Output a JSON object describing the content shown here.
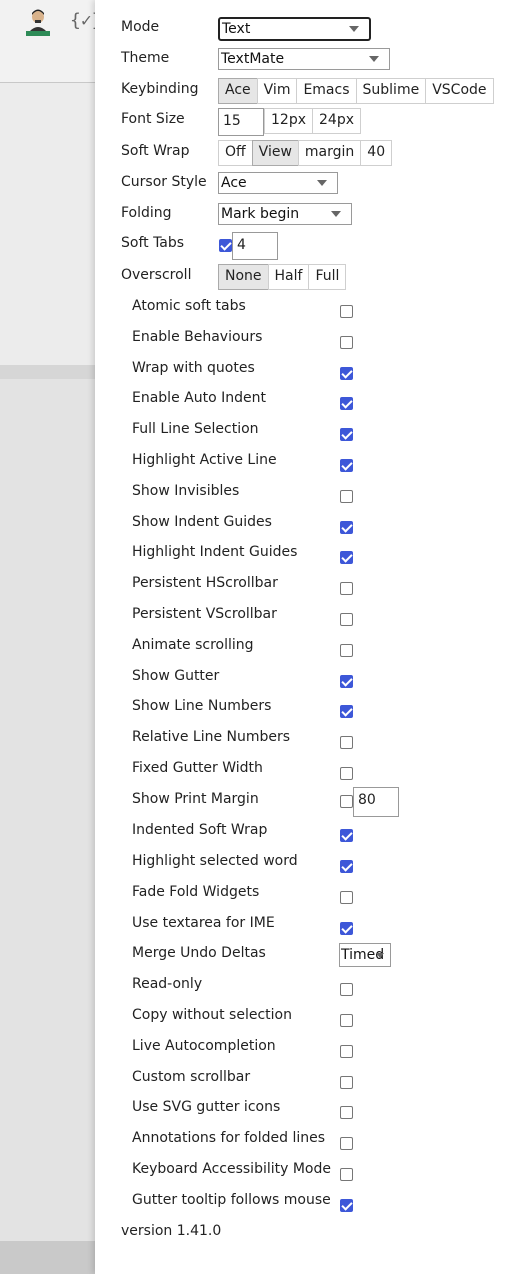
{
  "settings": {
    "mode": {
      "label": "Mode",
      "value": "Text"
    },
    "theme": {
      "label": "Theme",
      "value": "TextMate"
    },
    "keybinding": {
      "label": "Keybinding",
      "options": [
        "Ace",
        "Vim",
        "Emacs",
        "Sublime",
        "VSCode"
      ],
      "selected": "Ace"
    },
    "font_size": {
      "label": "Font Size",
      "value": "15",
      "options": [
        "12px",
        "24px"
      ]
    },
    "soft_wrap": {
      "label": "Soft Wrap",
      "options": [
        "Off",
        "View",
        "margin",
        "40"
      ],
      "selected": "View"
    },
    "cursor_style": {
      "label": "Cursor Style",
      "value": "Ace"
    },
    "folding": {
      "label": "Folding",
      "value": "Mark begin"
    },
    "soft_tabs": {
      "label": "Soft Tabs",
      "checked": true,
      "value": "4"
    },
    "overscroll": {
      "label": "Overscroll",
      "options": [
        "None",
        "Half",
        "Full"
      ],
      "selected": "None"
    }
  },
  "options": [
    {
      "label": "Atomic soft tabs",
      "checked": false
    },
    {
      "label": "Enable Behaviours",
      "checked": false
    },
    {
      "label": "Wrap with quotes",
      "checked": true
    },
    {
      "label": "Enable Auto Indent",
      "checked": true
    },
    {
      "label": "Full Line Selection",
      "checked": true
    },
    {
      "label": "Highlight Active Line",
      "checked": true
    },
    {
      "label": "Show Invisibles",
      "checked": false
    },
    {
      "label": "Show Indent Guides",
      "checked": true
    },
    {
      "label": "Highlight Indent Guides",
      "checked": true
    },
    {
      "label": "Persistent HScrollbar",
      "checked": false
    },
    {
      "label": "Persistent VScrollbar",
      "checked": false
    },
    {
      "label": "Animate scrolling",
      "checked": false
    },
    {
      "label": "Show Gutter",
      "checked": true
    },
    {
      "label": "Show Line Numbers",
      "checked": true
    },
    {
      "label": "Relative Line Numbers",
      "checked": false
    },
    {
      "label": "Fixed Gutter Width",
      "checked": false
    },
    {
      "label": "Show Print Margin",
      "checked": false,
      "value": "80"
    },
    {
      "label": "Indented Soft Wrap",
      "checked": true
    },
    {
      "label": "Highlight selected word",
      "checked": true
    },
    {
      "label": "Fade Fold Widgets",
      "checked": false
    },
    {
      "label": "Use textarea for IME",
      "checked": true
    },
    {
      "label": "Merge Undo Deltas",
      "select": "Timed"
    },
    {
      "label": "Read-only",
      "checked": false
    },
    {
      "label": "Copy without selection",
      "checked": false
    },
    {
      "label": "Live Autocompletion",
      "checked": false
    },
    {
      "label": "Custom scrollbar",
      "checked": false
    },
    {
      "label": "Use SVG gutter icons",
      "checked": false
    },
    {
      "label": "Annotations for folded lines",
      "checked": false
    },
    {
      "label": "Keyboard Accessibility Mode",
      "checked": false
    },
    {
      "label": "Gutter tooltip follows mouse",
      "checked": true
    }
  ],
  "version": "version 1.41.0",
  "icons": {
    "avatar": "user-avatar-icon",
    "brace": "json-brace-icon",
    "brace_text": "{✓}"
  },
  "colors": {
    "checkbox_on": "#3d57d8",
    "active_button": "#e6e6e6"
  }
}
